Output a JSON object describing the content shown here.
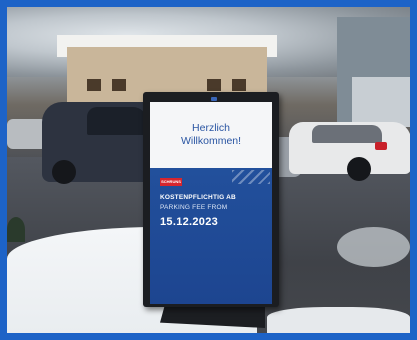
{
  "photo": {
    "subject": "parking-fee-display-kiosk",
    "border_color": "#1d63c7"
  },
  "screen": {
    "greeting_line1": "Herzlich",
    "greeting_line2": "Willkommen!",
    "logo_text": "SCHRUNS",
    "notice_line1": "KOSTENPFLICHTIG AB",
    "notice_line2": "PARKING FEE FROM",
    "date": "15.12.2023",
    "accent_color": "#22509c",
    "text_color": "#2b56a3"
  }
}
